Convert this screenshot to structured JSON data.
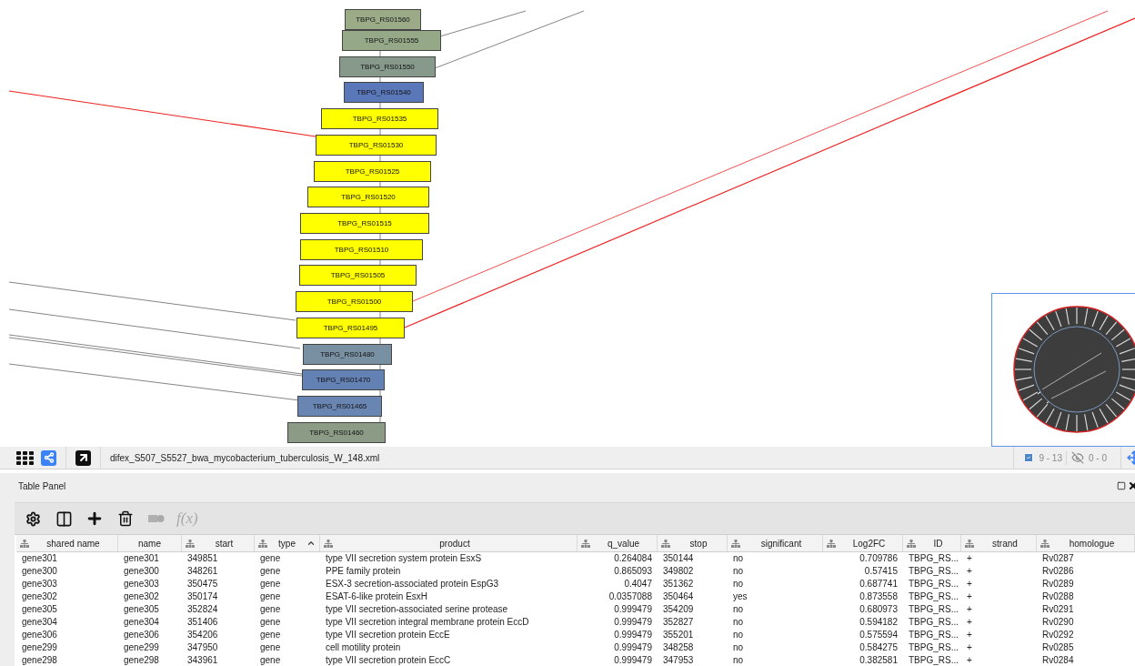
{
  "network": {
    "nodes": [
      {
        "label": "TBPG_RS01560",
        "color": "#9bab88"
      },
      {
        "label": "TBPG_RS01555",
        "color": "#95a887"
      },
      {
        "label": "TBPG_RS01550",
        "color": "#87998b"
      },
      {
        "label": "TBPG_RS01540",
        "color": "#5a78b9"
      },
      {
        "label": "TBPG_RS01535",
        "color": "#ffff00"
      },
      {
        "label": "TBPG_RS01530",
        "color": "#ffff00"
      },
      {
        "label": "TBPG_RS01525",
        "color": "#ffff00"
      },
      {
        "label": "TBPG_RS01520",
        "color": "#ffff00"
      },
      {
        "label": "TBPG_RS01515",
        "color": "#ffff00"
      },
      {
        "label": "TBPG_RS01510",
        "color": "#ffff00"
      },
      {
        "label": "TBPG_RS01505",
        "color": "#ffff00"
      },
      {
        "label": "TBPG_RS01500",
        "color": "#ffff00"
      },
      {
        "label": "TBPG_RS01495",
        "color": "#ffff00"
      },
      {
        "label": "TBPG_RS01480",
        "color": "#7890a2"
      },
      {
        "label": "TBPG_RS01470",
        "color": "#6481b3"
      },
      {
        "label": "TBPG_RS01465",
        "color": "#6985b1"
      },
      {
        "label": "TBPG_RS01460",
        "color": "#8b9b86"
      }
    ]
  },
  "network_bar": {
    "file": "difex_S507_S5527_bwa_mycobacterium_tuberculosis_W_148.xml",
    "selected_counts": "9 - 13",
    "hidden_counts": "0 - 0"
  },
  "table_panel": {
    "title": "Table Panel",
    "tools": [
      {
        "kind": "settings",
        "disabled": false
      },
      {
        "kind": "columns",
        "disabled": false
      },
      {
        "kind": "add",
        "disabled": false
      },
      {
        "kind": "delete",
        "disabled": false
      },
      {
        "kind": "map",
        "disabled": true
      },
      {
        "kind": "function",
        "label": "f(x)",
        "disabled": true
      }
    ],
    "columns": [
      {
        "label": "shared name",
        "shared": true,
        "sorted": false
      },
      {
        "label": "name",
        "shared": false,
        "sorted": false
      },
      {
        "label": "start",
        "shared": true,
        "sorted": false
      },
      {
        "label": "type",
        "shared": true,
        "sorted": true
      },
      {
        "label": "product",
        "shared": true,
        "sorted": false
      },
      {
        "label": "q_value",
        "shared": true,
        "sorted": false
      },
      {
        "label": "stop",
        "shared": true,
        "sorted": false
      },
      {
        "label": "significant",
        "shared": true,
        "sorted": false
      },
      {
        "label": "Log2FC",
        "shared": true,
        "sorted": false
      },
      {
        "label": "ID",
        "shared": true,
        "sorted": false
      },
      {
        "label": "strand",
        "shared": true,
        "sorted": false
      },
      {
        "label": "homologue",
        "shared": true,
        "sorted": false
      }
    ],
    "rows": [
      [
        "gene301",
        "gene301",
        "349851",
        "gene",
        "type VII secretion system protein EsxS",
        "0.264084",
        "350144",
        "no",
        "0.709786",
        "TBPG_RS...",
        "+",
        "Rv0287"
      ],
      [
        "gene300",
        "gene300",
        "348261",
        "gene",
        "PPE family protein",
        "0.865093",
        "349802",
        "no",
        "0.57415",
        "TBPG_RS...",
        "+",
        "Rv0286"
      ],
      [
        "gene303",
        "gene303",
        "350475",
        "gene",
        "ESX-3 secretion-associated protein EspG3",
        "0.4047",
        "351362",
        "no",
        "0.687741",
        "TBPG_RS...",
        "+",
        "Rv0289"
      ],
      [
        "gene302",
        "gene302",
        "350174",
        "gene",
        "ESAT-6-like protein EsxH",
        "0.0357088",
        "350464",
        "yes",
        "0.873558",
        "TBPG_RS...",
        "+",
        "Rv0288"
      ],
      [
        "gene305",
        "gene305",
        "352824",
        "gene",
        "type VII secretion-associated serine protease",
        "0.999479",
        "354209",
        "no",
        "0.680973",
        "TBPG_RS...",
        "+",
        "Rv0291"
      ],
      [
        "gene304",
        "gene304",
        "351406",
        "gene",
        "type VII secretion integral membrane protein EccD",
        "0.999479",
        "352827",
        "no",
        "0.594182",
        "TBPG_RS...",
        "+",
        "Rv0290"
      ],
      [
        "gene306",
        "gene306",
        "354206",
        "gene",
        "type VII secretion protein EccE",
        "0.999479",
        "355201",
        "no",
        "0.575594",
        "TBPG_RS...",
        "+",
        "Rv0292"
      ],
      [
        "gene299",
        "gene299",
        "347950",
        "gene",
        "cell motility protein",
        "0.999479",
        "348258",
        "no",
        "0.584275",
        "TBPG_RS...",
        "+",
        "Rv0285"
      ],
      [
        "gene298",
        "gene298",
        "343961",
        "gene",
        "type VII secretion protein EccC",
        "0.999479",
        "347953",
        "no",
        "0.382581",
        "TBPG_RS...",
        "+",
        "Rv0284"
      ]
    ]
  }
}
